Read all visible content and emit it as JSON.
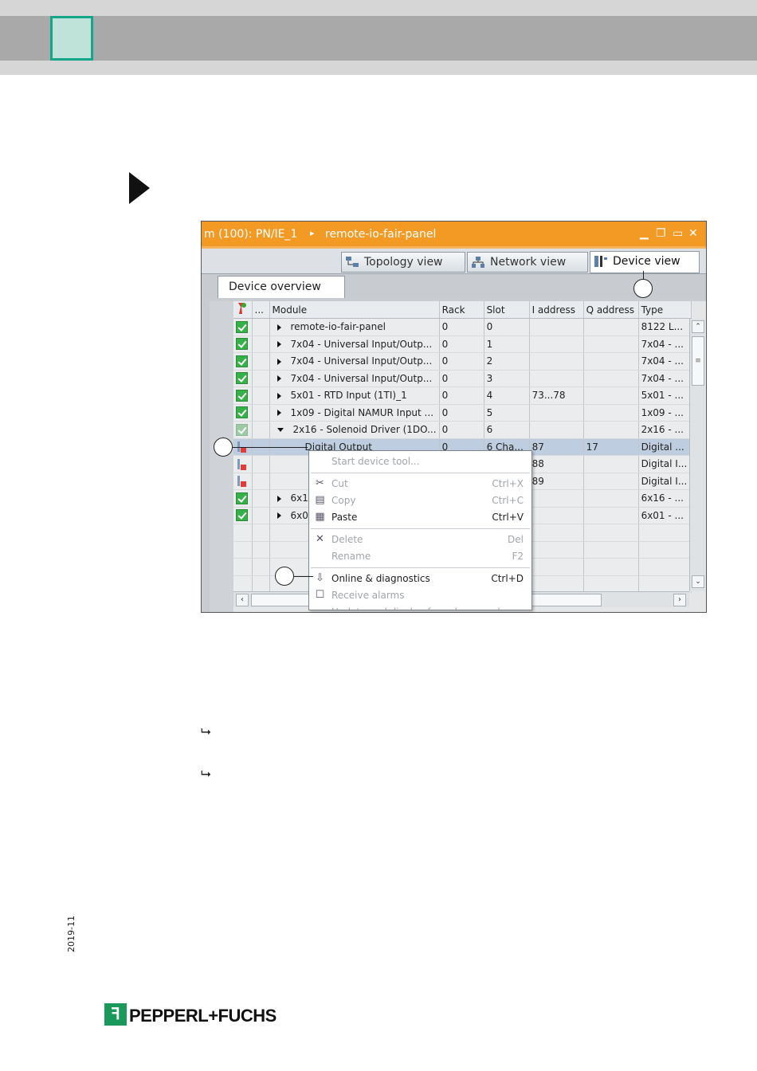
{
  "page": {
    "date_code": "2019-11",
    "logo_mark": "ꟻ",
    "logo_text": "PEPPERL+FUCHS",
    "result_arrows": [
      "⮡",
      "⮡"
    ]
  },
  "window": {
    "title_left": "m (100): PN/IE_1",
    "title_sep": "▸",
    "title_right": "remote-io-fair-panel",
    "controls": [
      "▁",
      "❐",
      "▭",
      "✕"
    ]
  },
  "views": [
    {
      "label": "Topology view",
      "icon": "topology-icon"
    },
    {
      "label": "Network view",
      "icon": "network-icon"
    },
    {
      "label": "Device view",
      "icon": "device-icon",
      "active": true
    }
  ],
  "overview_tab": "Device overview",
  "table": {
    "headers": [
      "",
      "...",
      "Module",
      "Rack",
      "Slot",
      "I address",
      "Q address",
      "Type"
    ],
    "rows": [
      {
        "status": "ok",
        "expand": "right",
        "module": "remote-io-fair-panel",
        "rack": "0",
        "slot": "0",
        "iaddr": "",
        "qaddr": "",
        "type": "8122 L..."
      },
      {
        "status": "ok",
        "expand": "right",
        "module": "7x04 - Universal Input/Outp...",
        "rack": "0",
        "slot": "1",
        "iaddr": "",
        "qaddr": "",
        "type": "7x04 - ..."
      },
      {
        "status": "ok",
        "expand": "right",
        "module": "7x04 - Universal Input/Outp...",
        "rack": "0",
        "slot": "2",
        "iaddr": "",
        "qaddr": "",
        "type": "7x04 - ..."
      },
      {
        "status": "ok",
        "expand": "right",
        "module": "7x04 - Universal Input/Outp...",
        "rack": "0",
        "slot": "3",
        "iaddr": "",
        "qaddr": "",
        "type": "7x04 - ..."
      },
      {
        "status": "ok",
        "expand": "right",
        "module": "5x01 - RTD Input (1TI)_1",
        "rack": "0",
        "slot": "4",
        "iaddr": "73...78",
        "qaddr": "",
        "type": "5x01 - ..."
      },
      {
        "status": "ok",
        "expand": "right",
        "module": "1x09 - Digital NAMUR Input ...",
        "rack": "0",
        "slot": "5",
        "iaddr": "",
        "qaddr": "",
        "type": "1x09 - ..."
      },
      {
        "status": "dim",
        "expand": "down",
        "module": "2x16 - Solenoid Driver (1DO...",
        "rack": "0",
        "slot": "6",
        "iaddr": "",
        "qaddr": "",
        "type": "2x16 - ..."
      },
      {
        "status": "err",
        "expand": "none",
        "module": "Digital Output",
        "rack": "0",
        "slot": "6 Cha...",
        "iaddr": "87",
        "qaddr": "17",
        "type": "Digital ...",
        "selected": true
      },
      {
        "status": "err",
        "expand": "none",
        "module": "",
        "rack": "",
        "slot": "",
        "iaddr": "88",
        "qaddr": "",
        "type": "Digital I..."
      },
      {
        "status": "err",
        "expand": "none",
        "module": "",
        "rack": "",
        "slot": "",
        "iaddr": "89",
        "qaddr": "",
        "type": "Digital I..."
      },
      {
        "status": "ok",
        "expand": "right",
        "module": "6x1",
        "rack": "",
        "slot": "",
        "iaddr": "",
        "qaddr": "",
        "type": "6x16 - ..."
      },
      {
        "status": "ok",
        "expand": "right",
        "module": "6x0",
        "rack": "",
        "slot": "",
        "iaddr": "",
        "qaddr": "",
        "type": "6x01 - ..."
      },
      {
        "status": "",
        "expand": "none",
        "module": "",
        "rack": "",
        "slot": "",
        "iaddr": "",
        "qaddr": "",
        "type": ""
      },
      {
        "status": "",
        "expand": "none",
        "module": "",
        "rack": "",
        "slot": "",
        "iaddr": "",
        "qaddr": "",
        "type": ""
      },
      {
        "status": "",
        "expand": "none",
        "module": "",
        "rack": "",
        "slot": "",
        "iaddr": "",
        "qaddr": "",
        "type": ""
      },
      {
        "status": "",
        "expand": "none",
        "module": "",
        "rack": "",
        "slot": "",
        "iaddr": "",
        "qaddr": "",
        "type": ""
      }
    ]
  },
  "scroll": {
    "up": "⌃",
    "down": "⌄",
    "grip": "≡",
    "left": "‹",
    "right": "›"
  },
  "context_menu": [
    {
      "label": "Start device tool...",
      "shortcut": "",
      "enabled": false,
      "icon": ""
    },
    {
      "sep": true
    },
    {
      "label": "Cut",
      "shortcut": "Ctrl+X",
      "enabled": false,
      "icon": "✂"
    },
    {
      "label": "Copy",
      "shortcut": "Ctrl+C",
      "enabled": false,
      "icon": "▤"
    },
    {
      "label": "Paste",
      "shortcut": "Ctrl+V",
      "enabled": true,
      "icon": "▦"
    },
    {
      "sep": true
    },
    {
      "label": "Delete",
      "shortcut": "Del",
      "enabled": false,
      "icon": "✕"
    },
    {
      "label": "Rename",
      "shortcut": "F2",
      "enabled": false,
      "icon": ""
    },
    {
      "sep": true
    },
    {
      "label": "Online & diagnostics",
      "shortcut": "Ctrl+D",
      "enabled": true,
      "icon": "⇩"
    },
    {
      "label": "Receive alarms",
      "shortcut": "",
      "enabled": false,
      "icon": "☐"
    },
    {
      "label": "Update and display forced operands",
      "shortcut": "",
      "enabled": false,
      "icon": ""
    }
  ],
  "colors": {
    "titlebar": "#f39a24",
    "chapter_box_fill": "#bfe3d8",
    "chapter_box_border": "#14a58d",
    "selected_row": "#bfcde0",
    "status_ok": "#37b04a",
    "logo_green": "#1a9a5a"
  }
}
